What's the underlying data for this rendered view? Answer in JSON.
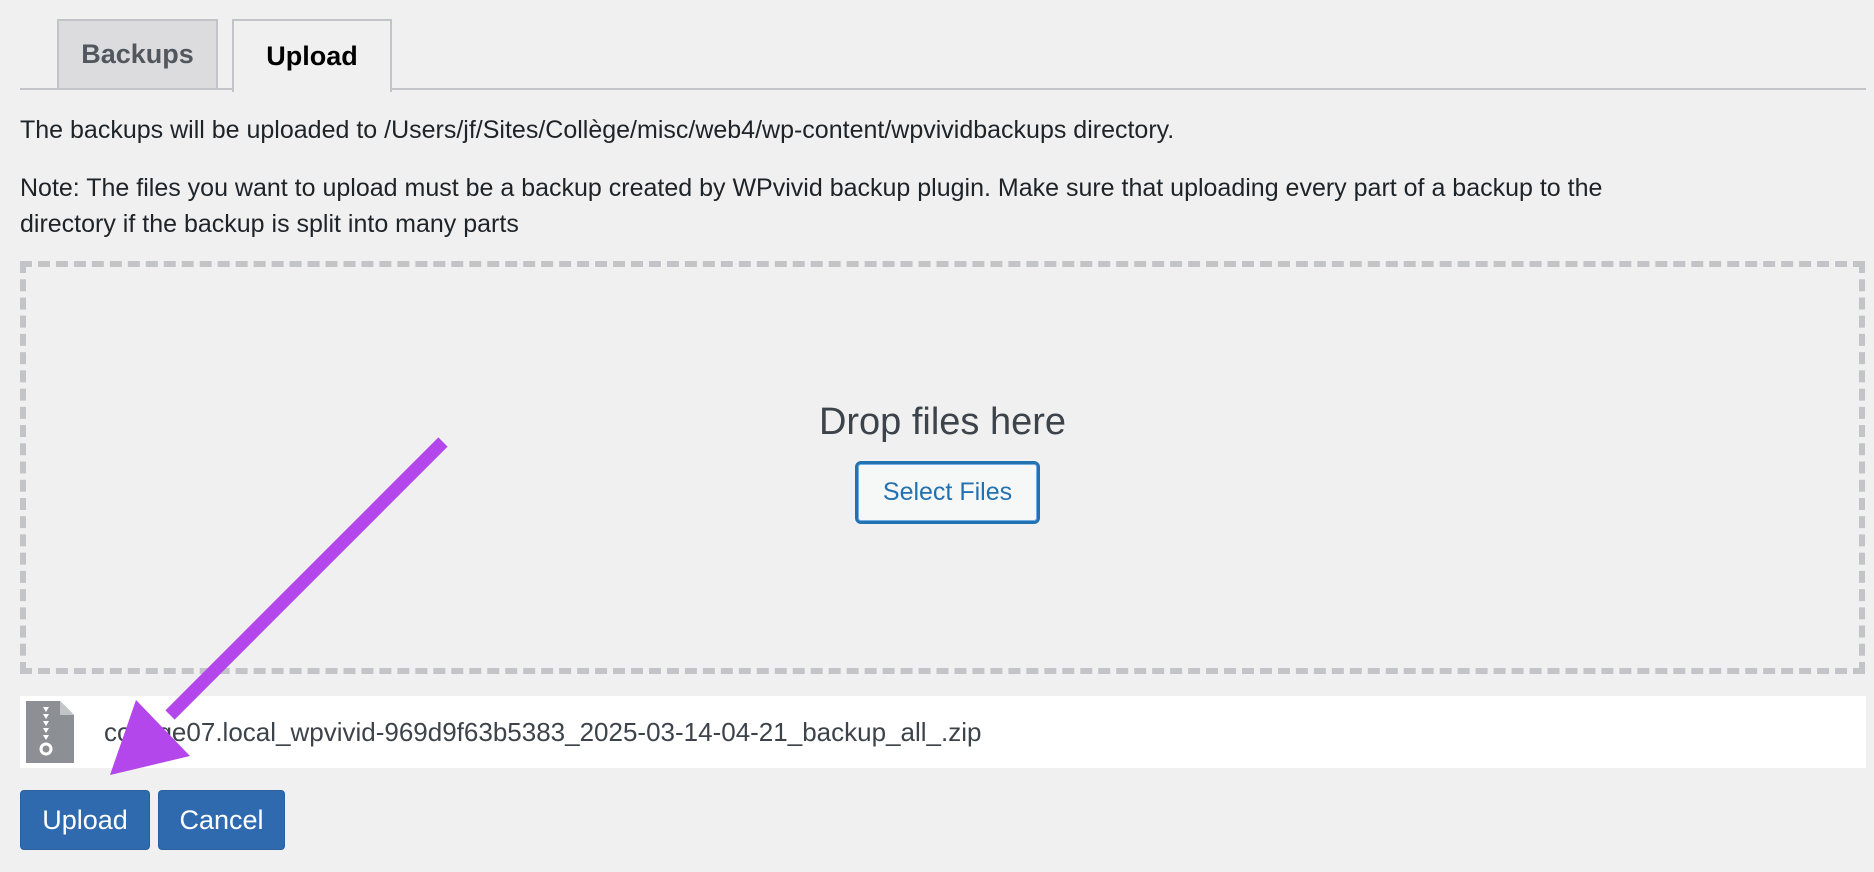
{
  "tabs": [
    {
      "label": "Backups",
      "active": false
    },
    {
      "label": "Upload",
      "active": true
    }
  ],
  "info": {
    "upload_path_text": "The backups will be uploaded to /Users/jf/Sites/Collège/misc/web4/wp-content/wpvividbackups directory.",
    "note_line1": "Note: The files you want to upload must be a backup created by WPvivid backup plugin. Make sure that uploading every part of a backup to the",
    "note_line2": "directory if the backup is split into many parts"
  },
  "dropzone": {
    "title": "Drop files here",
    "select_label": "Select Files"
  },
  "file": {
    "name": "college07.local_wpvivid-969d9f63b5383_2025-03-14-04-21_backup_all_.zip",
    "icon": "zip-file-icon"
  },
  "actions": {
    "upload_label": "Upload",
    "cancel_label": "Cancel"
  },
  "annotation": {
    "icon": "arrow-pointer",
    "color": "#b347eb"
  },
  "colors": {
    "primary": "#2271b1",
    "button_bg": "#2f6aae",
    "background": "#f0f0f1"
  }
}
